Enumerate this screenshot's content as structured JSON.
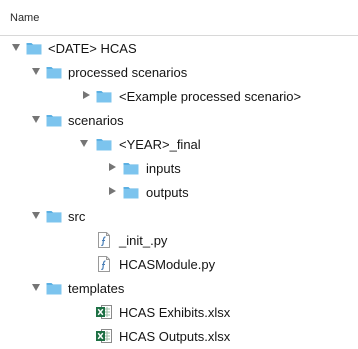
{
  "header": {
    "column_name": "Name"
  },
  "tree": [
    {
      "label": "<DATE> HCAS",
      "type": "folder",
      "expanded": true,
      "depth": 0
    },
    {
      "label": "processed scenarios",
      "type": "folder",
      "expanded": true,
      "depth": 1
    },
    {
      "label": "<Example processed scenario>",
      "type": "folder",
      "expanded": false,
      "depth": 2
    },
    {
      "label": "scenarios",
      "type": "folder",
      "expanded": true,
      "depth": 1
    },
    {
      "label": "<YEAR>_final",
      "type": "folder",
      "expanded": true,
      "depth": 2
    },
    {
      "label": "inputs",
      "type": "folder",
      "expanded": false,
      "depth": 3
    },
    {
      "label": "outputs",
      "type": "folder",
      "expanded": false,
      "depth": 3
    },
    {
      "label": "src",
      "type": "folder",
      "expanded": true,
      "depth": 1
    },
    {
      "label": "_init_.py",
      "type": "python",
      "depth": 2
    },
    {
      "label": "HCASModule.py",
      "type": "python",
      "depth": 2
    },
    {
      "label": "templates",
      "type": "folder",
      "expanded": true,
      "depth": 1
    },
    {
      "label": "HCAS Exhibits.xlsx",
      "type": "excel",
      "depth": 2
    },
    {
      "label": "HCAS Outputs.xlsx",
      "type": "excel",
      "depth": 2
    }
  ],
  "colors": {
    "folder": "#7cc4ee",
    "folder_tab": "#5bb0e3",
    "disclosure": "#757575",
    "excel": "#1d7044"
  }
}
